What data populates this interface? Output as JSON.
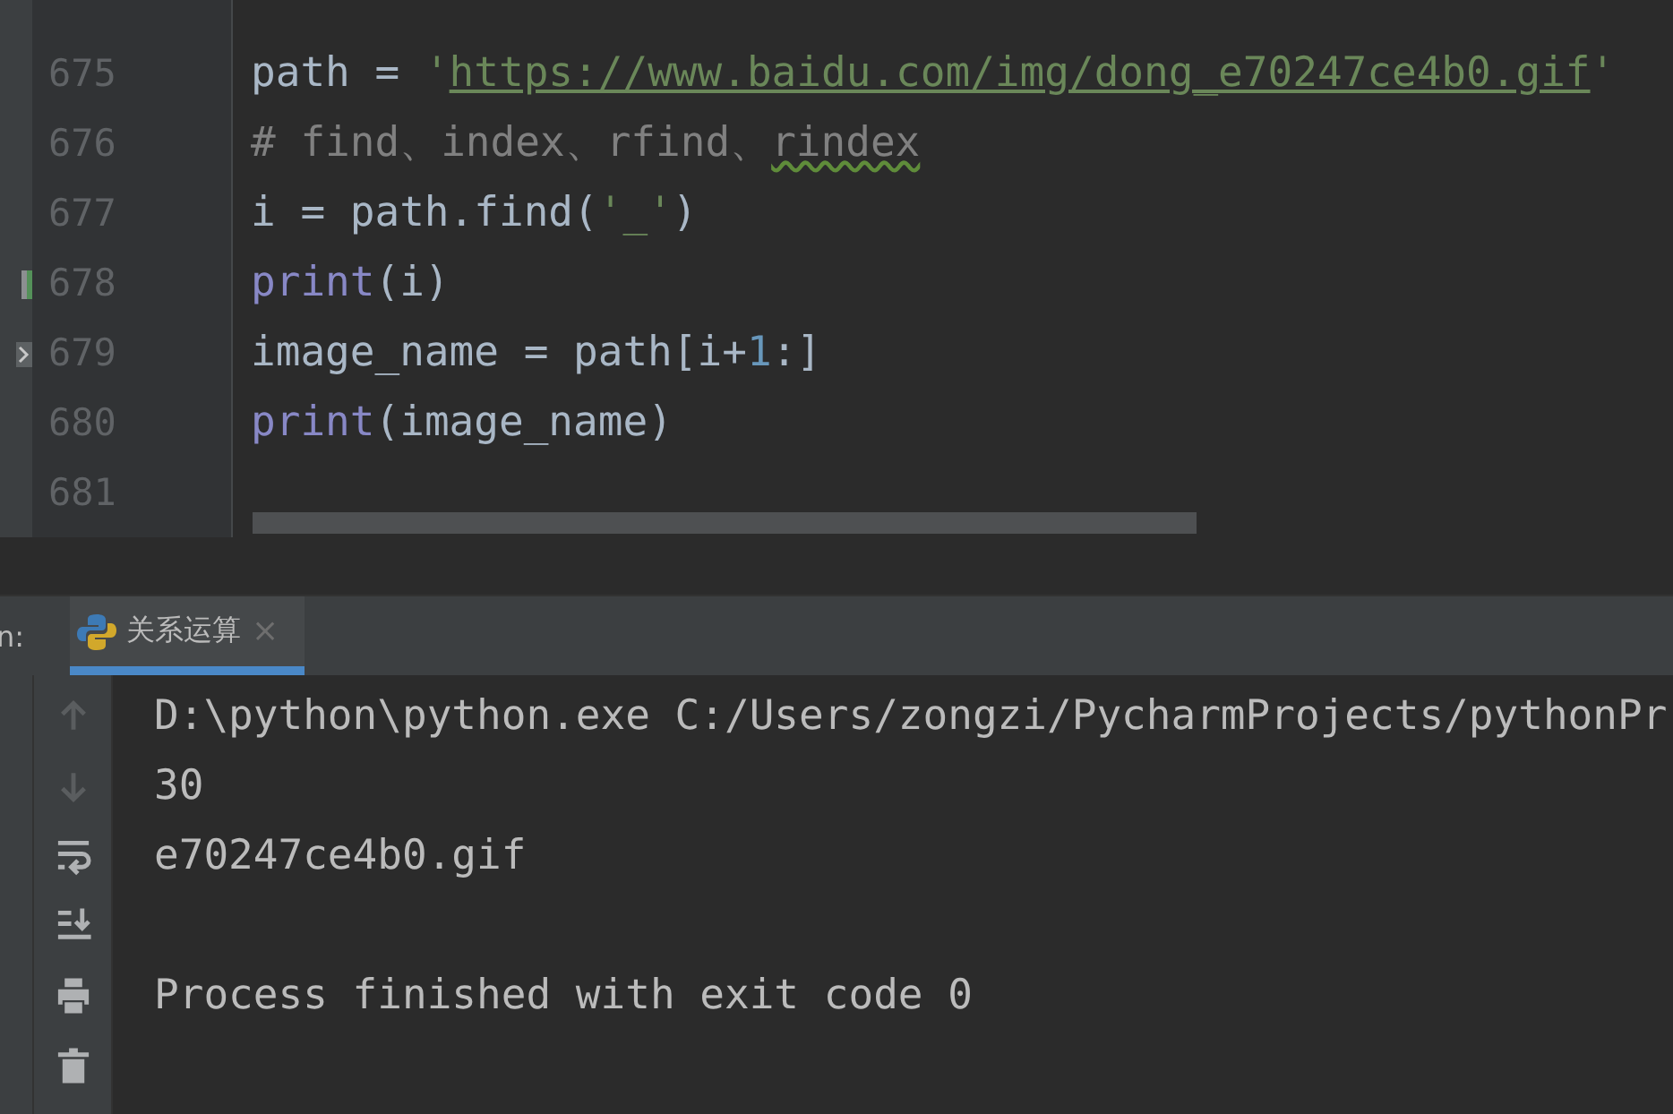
{
  "editor": {
    "lines": [
      {
        "number": "675",
        "tokens": [
          {
            "kind": "plain",
            "text": "path = "
          },
          {
            "kind": "string",
            "text": "'"
          },
          {
            "kind": "link",
            "text": "https://www.baidu.com/img/dong_e70247ce4b0.gif"
          },
          {
            "kind": "string",
            "text": "'"
          }
        ]
      },
      {
        "number": "676",
        "tokens": [
          {
            "kind": "comment",
            "text": "# find、index、rfind、"
          },
          {
            "kind": "typo",
            "text": "rindex"
          }
        ]
      },
      {
        "number": "677",
        "tokens": [
          {
            "kind": "plain",
            "text": "i = path.find("
          },
          {
            "kind": "string",
            "text": "'_'"
          },
          {
            "kind": "plain",
            "text": ")"
          }
        ]
      },
      {
        "number": "678",
        "changed": true,
        "tokens": [
          {
            "kind": "builtin",
            "text": "print"
          },
          {
            "kind": "plain",
            "text": "(i)"
          }
        ]
      },
      {
        "number": "679",
        "folded": true,
        "tokens": [
          {
            "kind": "plain",
            "text": "image_name = path[i+"
          },
          {
            "kind": "number",
            "text": "1"
          },
          {
            "kind": "plain",
            "text": ":]"
          }
        ]
      },
      {
        "number": "680",
        "tokens": [
          {
            "kind": "builtin",
            "text": "print"
          },
          {
            "kind": "plain",
            "text": "(image_name)"
          }
        ]
      },
      {
        "number": "681"
      }
    ]
  },
  "run_panel": {
    "label": "n:",
    "tabs": [
      {
        "title": "关系运算",
        "selected": true,
        "close": "×"
      }
    ],
    "toolbar": [
      {
        "kind": "up",
        "disabled": true
      },
      {
        "kind": "down",
        "disabled": true
      },
      {
        "kind": "wrap",
        "disabled": false
      },
      {
        "kind": "scroll-end",
        "disabled": false
      },
      {
        "kind": "print",
        "disabled": false
      },
      {
        "kind": "trash",
        "disabled": false
      }
    ],
    "console": [
      {
        "text": "D:\\python\\python.exe C:/Users/zongzi/PycharmProjects/pythonPr",
        "blank_before": false
      },
      {
        "text": "30",
        "blank_before": false
      },
      {
        "text": "e70247ce4b0.gif",
        "blank_before": false
      },
      {
        "text": "Process finished with exit code 0",
        "blank_before": true
      }
    ]
  }
}
